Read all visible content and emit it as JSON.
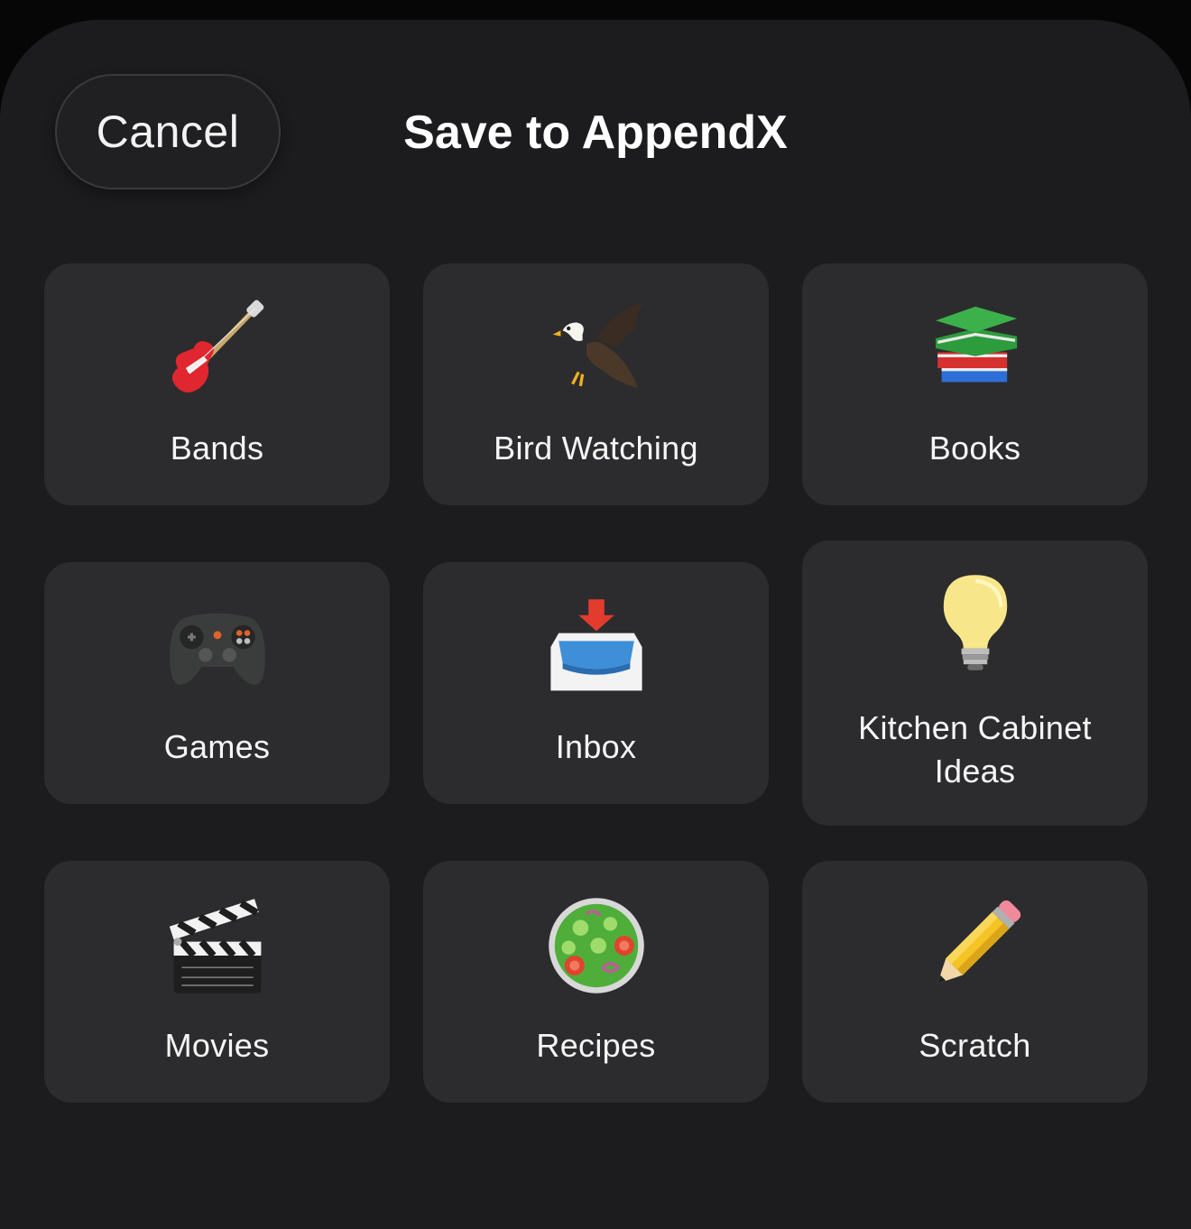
{
  "header": {
    "cancel_label": "Cancel",
    "title": "Save to AppendX"
  },
  "collections": [
    {
      "label": "Bands",
      "icon": "guitar-icon"
    },
    {
      "label": "Bird Watching",
      "icon": "eagle-icon"
    },
    {
      "label": "Books",
      "icon": "books-icon"
    },
    {
      "label": "Games",
      "icon": "game-controller-icon"
    },
    {
      "label": "Inbox",
      "icon": "inbox-tray-icon"
    },
    {
      "label": "Kitchen Cabinet Ideas",
      "icon": "light-bulb-icon"
    },
    {
      "label": "Movies",
      "icon": "clapper-board-icon"
    },
    {
      "label": "Recipes",
      "icon": "salad-icon"
    },
    {
      "label": "Scratch",
      "icon": "pencil-icon"
    }
  ],
  "colors": {
    "background": "#1c1c1e",
    "tile": "#2c2c2e",
    "text": "#f5f5f5"
  }
}
